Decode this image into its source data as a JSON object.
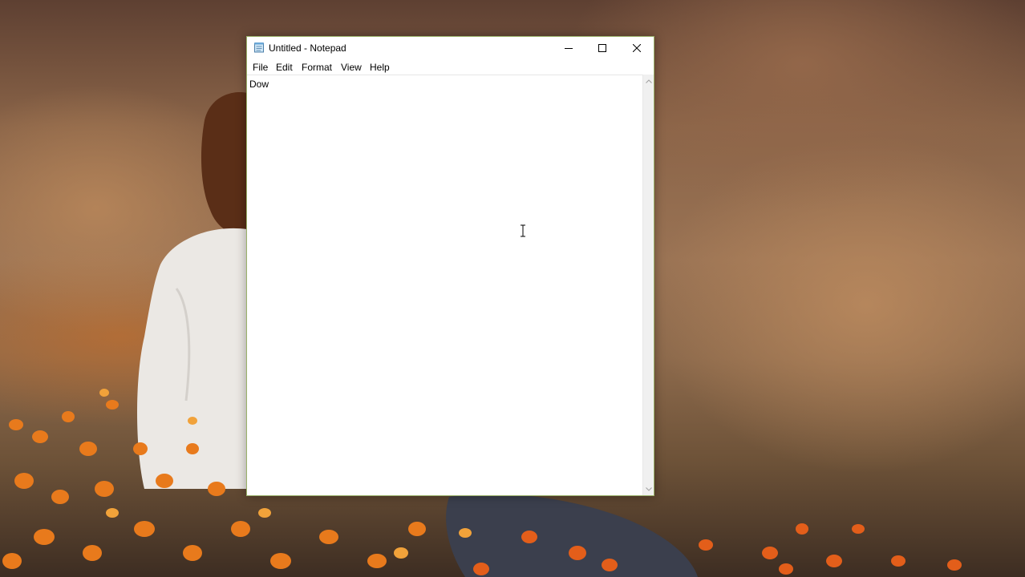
{
  "window": {
    "title": "Untitled - Notepad",
    "minimize_icon": "minimize-icon",
    "maximize_icon": "maximize-icon",
    "close_icon": "close-icon"
  },
  "menu": {
    "items": [
      {
        "label": "File"
      },
      {
        "label": "Edit"
      },
      {
        "label": "Format"
      },
      {
        "label": "View"
      },
      {
        "label": "Help"
      }
    ]
  },
  "editor": {
    "content": "Dow"
  },
  "colors": {
    "window_border": "#9ab26a",
    "editor_bg": "#ffffff",
    "scrollbar_bg": "#f0f0f0"
  }
}
